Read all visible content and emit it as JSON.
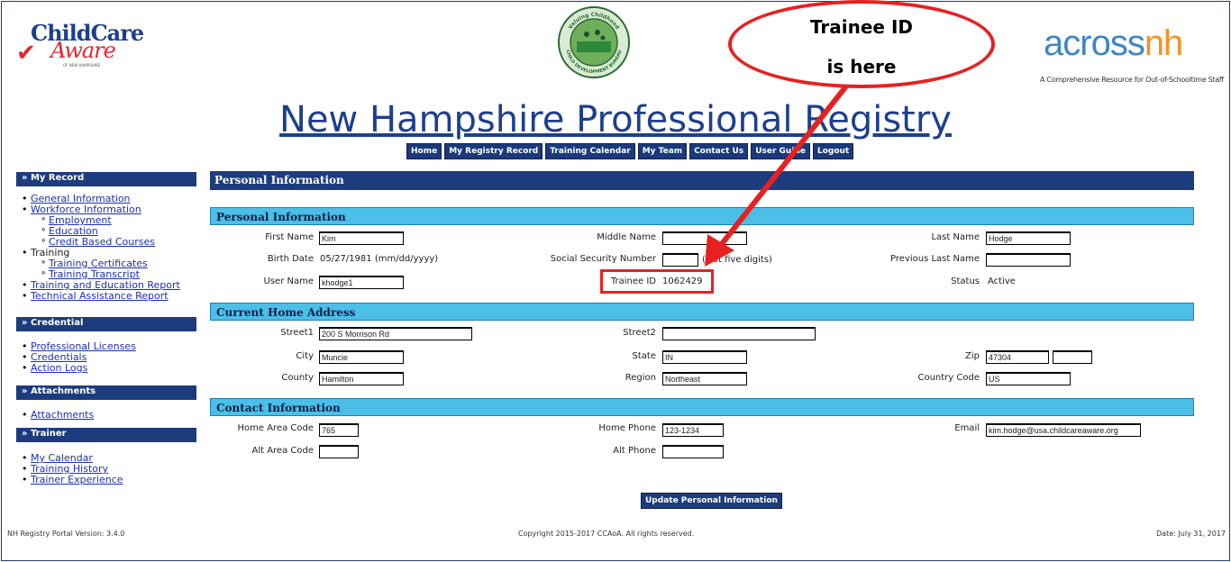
{
  "header": {
    "left_logo_line1": "ChildCare",
    "left_logo_line2": "Aware",
    "left_logo_sub": "OF NEW HAMPSHIRE",
    "mid_logo_top": "Valuing Childhood",
    "mid_logo_bottom": "CHILD DEVELOPMENT BUREAU",
    "right_logo_a": "across",
    "right_logo_b": "nh",
    "right_logo_sub": "A Comprehensive Resource for Out-of-Schooltime Staff",
    "site_title": "New Hampshire Professional Registry"
  },
  "topnav": [
    "Home",
    "My Registry Record",
    "Training Calendar",
    "My Team",
    "Contact Us",
    "User Guide",
    "Logout"
  ],
  "sidebar": {
    "my_record": {
      "title": "» My Record",
      "general": "General Information",
      "workforce": "Workforce Information",
      "employment": "Employment",
      "education": "Education",
      "credit": "Credit Based Courses",
      "training": "Training",
      "certificates": "Training Certificates",
      "transcript": "Training Transcript",
      "report": "Training and Education Report",
      "technical": "Technical Assistance Report"
    },
    "credential": {
      "title": "» Credential",
      "licenses": "Professional Licenses",
      "credentials": "Credentials",
      "logs": "Action Logs"
    },
    "attachments": {
      "title": "» Attachments",
      "item": "Attachments"
    },
    "trainer": {
      "title": "» Trainer",
      "calendar": "My Calendar",
      "history": "Training History",
      "experience": "Trainer Experience"
    }
  },
  "main": {
    "title": "Personal Information",
    "personal": {
      "heading": "Personal Information",
      "first_name_label": "First Name",
      "first_name": "Kim",
      "middle_name_label": "Middle Name",
      "middle_name": "",
      "last_name_label": "Last Name",
      "last_name": "Hodge",
      "birth_date_label": "Birth Date",
      "birth_date": "05/27/1981 (mm/dd/yyyy)",
      "ssn_label": "Social Security Number",
      "ssn": "",
      "ssn_hint": "(last five digits)",
      "prev_last_label": "Previous Last Name",
      "prev_last": "",
      "username_label": "User Name",
      "username": "khodge1",
      "trainee_id_label": "Trainee ID",
      "trainee_id": "1062429",
      "status_label": "Status",
      "status": "Active"
    },
    "address": {
      "heading": "Current Home Address",
      "street1_label": "Street1",
      "street1": "200 S Morrison Rd",
      "street2_label": "Street2",
      "street2": "",
      "city_label": "City",
      "city": "Muncie",
      "state_label": "State",
      "state": "IN",
      "zip_label": "Zip",
      "zip": "47304",
      "zip_ext": "",
      "county_label": "County",
      "county": "Hamilton",
      "region_label": "Region",
      "region": "Northeast",
      "country_label": "Country Code",
      "country": "US"
    },
    "contact": {
      "heading": "Contact Information",
      "home_area_label": "Home Area Code",
      "home_area": "765",
      "home_phone_label": "Home Phone",
      "home_phone": "123-1234",
      "email_label": "Email",
      "email": "kim.hodge@usa.childcareaware.org",
      "alt_area_label": "Alt Area Code",
      "alt_area": "",
      "alt_phone_label": "Alt Phone",
      "alt_phone": ""
    },
    "update_button": "Update Personal Information"
  },
  "footer": {
    "version": "NH Registry Portal Version: 3.4.0",
    "copyright": "Copyright 2015-2017 CCAoA. All rights reserved.",
    "date": "Date: July 31, 2017"
  },
  "annotation": {
    "line1": "Trainee ID",
    "line2": "is here",
    "color": "#e82020"
  }
}
